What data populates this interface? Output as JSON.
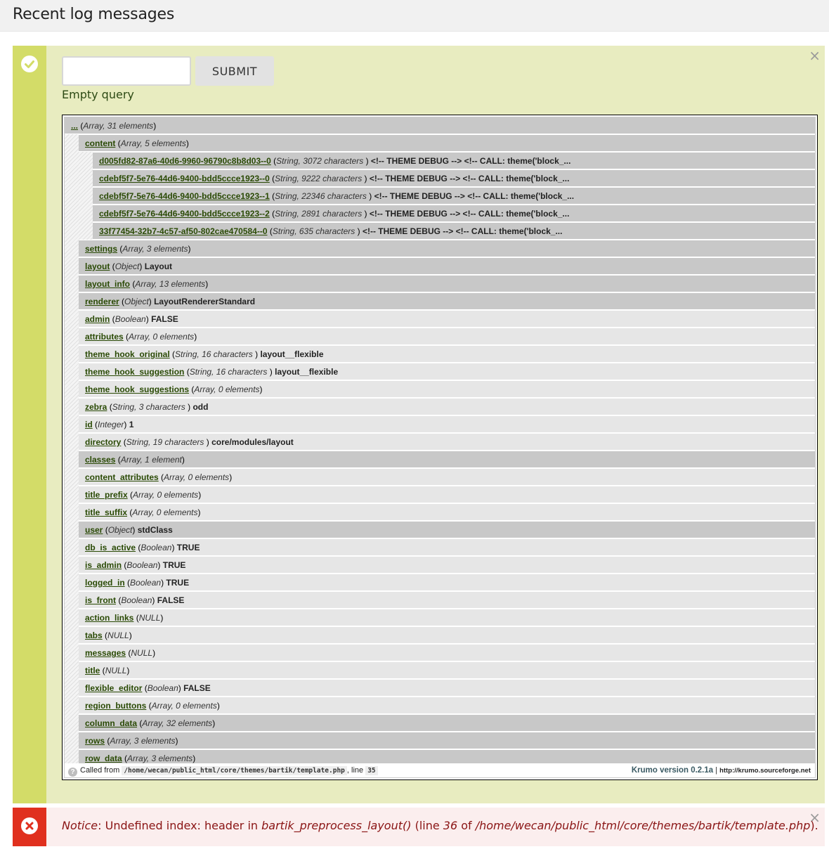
{
  "page": {
    "title": "Recent log messages"
  },
  "status": {
    "input_value": "",
    "submit_label": "SUBMIT",
    "message": "Empty query",
    "close_glyph": "×",
    "colors": {
      "background": "#e8ecc0",
      "stripe": "#d3dc68"
    }
  },
  "krumo": {
    "rows": [
      {
        "name": "...",
        "type": "Array, 31 elements",
        "value": "",
        "depth": 0,
        "style": "expand"
      },
      {
        "name": "content",
        "type": "Array, 5 elements",
        "value": "",
        "depth": 1,
        "style": "expand"
      },
      {
        "name": "d005fd82-87a6-40d6-9960-96790c8b8d03--0",
        "type": "String, 3072 characters ",
        "value": "<!-- THEME DEBUG --> <!-- CALL: theme('block_...",
        "depth": 2,
        "style": "expand"
      },
      {
        "name": "cdebf5f7-5e76-44d6-9400-bdd5ccce1923--0",
        "type": "String, 9222 characters ",
        "value": "<!-- THEME DEBUG --> <!-- CALL: theme('block_...",
        "depth": 2,
        "style": "expand"
      },
      {
        "name": "cdebf5f7-5e76-44d6-9400-bdd5ccce1923--1",
        "type": "String, 22346 characters ",
        "value": "<!-- THEME DEBUG --> <!-- CALL: theme('block_...",
        "depth": 2,
        "style": "expand"
      },
      {
        "name": "cdebf5f7-5e76-44d6-9400-bdd5ccce1923--2",
        "type": "String, 2891 characters ",
        "value": "<!-- THEME DEBUG --> <!-- CALL: theme('block_...",
        "depth": 2,
        "style": "expand"
      },
      {
        "name": "33f77454-32b7-4c57-af50-802cae470584--0",
        "type": "String, 635 characters ",
        "value": "<!-- THEME DEBUG --> <!-- CALL: theme('block_...",
        "depth": 2,
        "style": "expand"
      },
      {
        "name": "settings",
        "type": "Array, 3 elements",
        "value": "",
        "depth": 1,
        "style": "expand"
      },
      {
        "name": "layout",
        "type": "Object",
        "value": "Layout",
        "depth": 1,
        "style": "expand"
      },
      {
        "name": "layout_info",
        "type": "Array, 13 elements",
        "value": "",
        "depth": 1,
        "style": "expand"
      },
      {
        "name": "renderer",
        "type": "Object",
        "value": "LayoutRendererStandard",
        "depth": 1,
        "style": "expand"
      },
      {
        "name": "admin",
        "type": "Boolean",
        "value": "FALSE",
        "depth": 1,
        "style": "leaf"
      },
      {
        "name": "attributes",
        "type": "Array, 0 elements",
        "value": "",
        "depth": 1,
        "style": "leaf"
      },
      {
        "name": "theme_hook_original",
        "type": "String, 16 characters ",
        "value": "layout__flexible",
        "depth": 1,
        "style": "leaf"
      },
      {
        "name": "theme_hook_suggestion",
        "type": "String, 16 characters ",
        "value": "layout__flexible",
        "depth": 1,
        "style": "leaf"
      },
      {
        "name": "theme_hook_suggestions",
        "type": "Array, 0 elements",
        "value": "",
        "depth": 1,
        "style": "leaf"
      },
      {
        "name": "zebra",
        "type": "String, 3 characters ",
        "value": "odd",
        "depth": 1,
        "style": "leaf"
      },
      {
        "name": "id",
        "type": "Integer",
        "value": "1",
        "depth": 1,
        "style": "leaf"
      },
      {
        "name": "directory",
        "type": "String, 19 characters ",
        "value": "core/modules/layout",
        "depth": 1,
        "style": "leaf"
      },
      {
        "name": "classes",
        "type": "Array, 1 element",
        "value": "",
        "depth": 1,
        "style": "expand"
      },
      {
        "name": "content_attributes",
        "type": "Array, 0 elements",
        "value": "",
        "depth": 1,
        "style": "leaf"
      },
      {
        "name": "title_prefix",
        "type": "Array, 0 elements",
        "value": "",
        "depth": 1,
        "style": "leaf"
      },
      {
        "name": "title_suffix",
        "type": "Array, 0 elements",
        "value": "",
        "depth": 1,
        "style": "leaf"
      },
      {
        "name": "user",
        "type": "Object",
        "value": "stdClass",
        "depth": 1,
        "style": "expand"
      },
      {
        "name": "db_is_active",
        "type": "Boolean",
        "value": "TRUE",
        "depth": 1,
        "style": "leaf"
      },
      {
        "name": "is_admin",
        "type": "Boolean",
        "value": "TRUE",
        "depth": 1,
        "style": "leaf"
      },
      {
        "name": "logged_in",
        "type": "Boolean",
        "value": "TRUE",
        "depth": 1,
        "style": "leaf"
      },
      {
        "name": "is_front",
        "type": "Boolean",
        "value": "FALSE",
        "depth": 1,
        "style": "leaf"
      },
      {
        "name": "action_links",
        "type": "NULL",
        "value": "",
        "depth": 1,
        "style": "leaf"
      },
      {
        "name": "tabs",
        "type": "NULL",
        "value": "",
        "depth": 1,
        "style": "leaf"
      },
      {
        "name": "messages",
        "type": "NULL",
        "value": "",
        "depth": 1,
        "style": "leaf"
      },
      {
        "name": "title",
        "type": "NULL",
        "value": "",
        "depth": 1,
        "style": "leaf"
      },
      {
        "name": "flexible_editor",
        "type": "Boolean",
        "value": "FALSE",
        "depth": 1,
        "style": "leaf"
      },
      {
        "name": "region_buttons",
        "type": "Array, 0 elements",
        "value": "",
        "depth": 1,
        "style": "leaf"
      },
      {
        "name": "column_data",
        "type": "Array, 32 elements",
        "value": "",
        "depth": 1,
        "style": "expand"
      },
      {
        "name": "rows",
        "type": "Array, 3 elements",
        "value": "",
        "depth": 1,
        "style": "expand"
      },
      {
        "name": "row_data",
        "type": "Array, 3 elements",
        "value": "",
        "depth": 1,
        "style": "expand"
      }
    ],
    "footer": {
      "called_from_label": "Called from",
      "file_path": "/home/wecan/public_html/core/themes/bartik/template.php",
      "line_label": ", line",
      "line_number": "35",
      "version_label": "Krumo version 0.2.1a",
      "separator": "|",
      "link": "http://krumo.sourceforge.net"
    }
  },
  "error": {
    "prefix": "Notice",
    "text_1": ": Undefined index: header in ",
    "function_name": "bartik_preprocess_layout()",
    "text_2": " (line ",
    "line": "36",
    "text_3": " of ",
    "file": "/home/wecan/public_html/core/themes/bartik/template.php",
    "text_4": ").",
    "close_glyph": "×",
    "colors": {
      "background": "#fbeeee",
      "stripe": "#e0301e"
    }
  }
}
